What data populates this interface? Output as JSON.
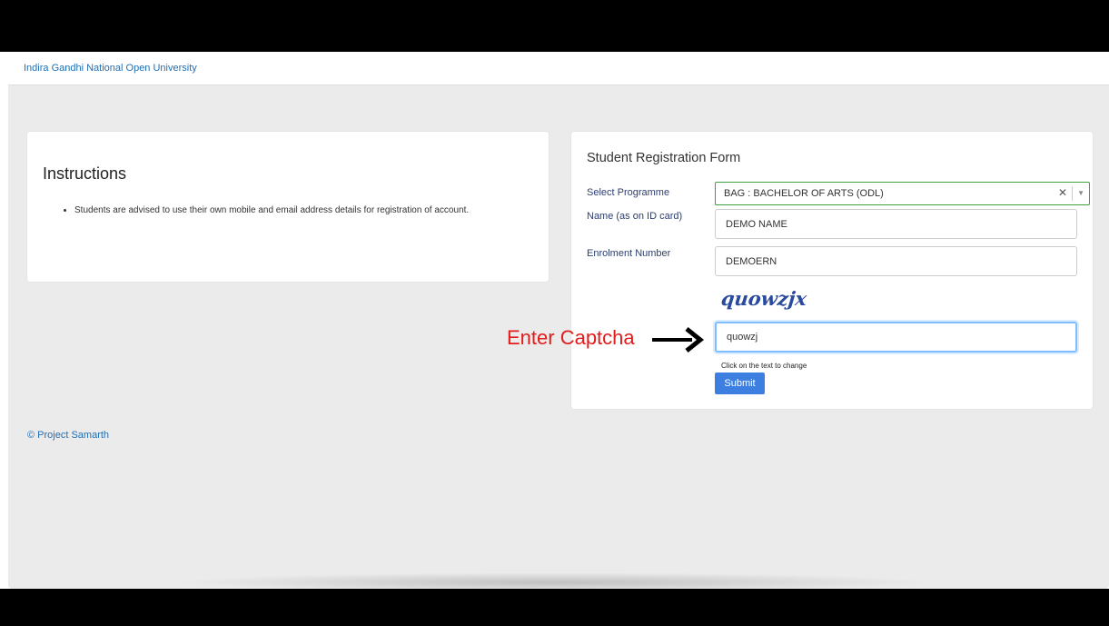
{
  "navbar": {
    "brand": "Indira Gandhi National Open University"
  },
  "instructions": {
    "title": "Instructions",
    "items": [
      "Students are advised to use their own mobile and email address details for registration of account."
    ]
  },
  "form": {
    "title": "Student Registration Form",
    "programme_label": "Select Programme",
    "programme_value": "BAG : BACHELOR OF ARTS (ODL)",
    "name_label": "Name (as on ID card)",
    "name_value": "DEMO NAME",
    "enrolment_label": "Enrolment Number",
    "enrolment_value": "DEMOERN",
    "captcha_text": "quowzjx",
    "captcha_value": "quowzj",
    "captcha_hint": "Click on the text to change",
    "submit_label": "Submit"
  },
  "annotation": {
    "text": "Enter Captcha"
  },
  "footer": {
    "text": "© Project Samarth"
  },
  "colors": {
    "brand_link": "#1f6fb5",
    "submit_button": "#3d7fe0",
    "annotation": "#e21b1b",
    "select_border": "#3fa13f",
    "captcha": "#2a4a9e"
  },
  "icons": {
    "clear": "close-icon",
    "dropdown": "chevron-down-icon",
    "annotation_arrow": "arrow-right-icon"
  }
}
